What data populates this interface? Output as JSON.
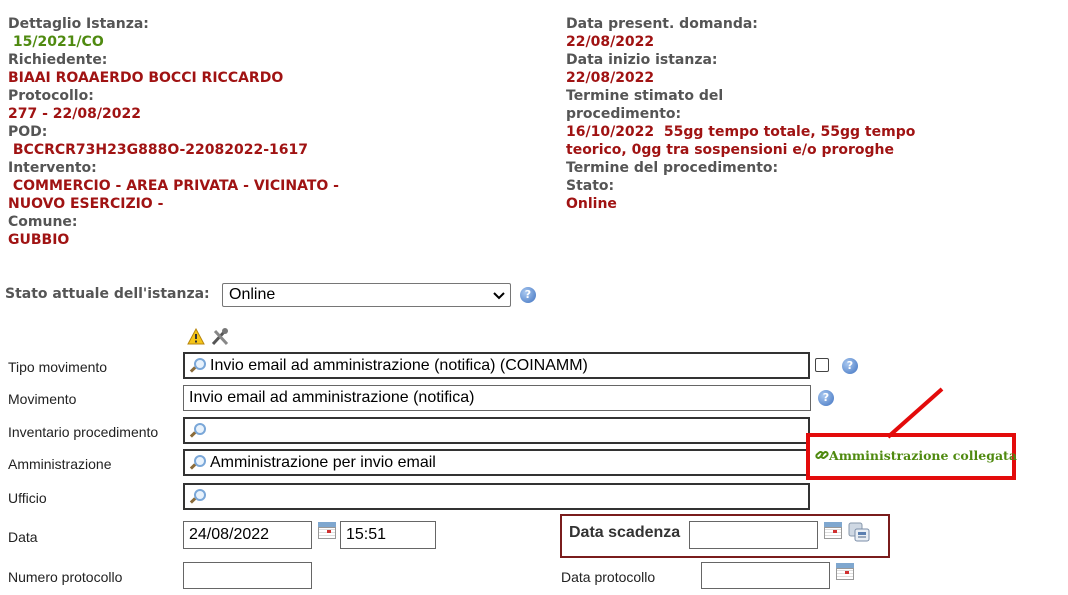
{
  "detail": {
    "left": [
      {
        "label": "Dettaglio Istanza:",
        "value": " 15/2021/CO",
        "value_color": "green"
      },
      {
        "label": "Richiedente:",
        "value": "BIAAI ROAAERDO BOCCI RICCARDO"
      },
      {
        "label": "Protocollo:",
        "value": "277 - 22/08/2022"
      },
      {
        "label": "POD:",
        "value": " BCCRCR73H23G888O-22082022-1617"
      },
      {
        "label": "Intervento:",
        "value_lines": [
          " COMMERCIO - AREA PRIVATA - VICINATO -",
          "NUOVO ESERCIZIO -"
        ]
      },
      {
        "label": "Comune:",
        "value": "GUBBIO"
      }
    ],
    "right": [
      {
        "label": "Data present. domanda:",
        "value": "22/08/2022"
      },
      {
        "label": "Data inizio istanza:",
        "value": "22/08/2022"
      },
      {
        "label_lines": [
          "Termine stimato del",
          "procedimento:"
        ],
        "value_lines": [
          "16/10/2022  55gg tempo totale, 55gg tempo",
          "teorico, 0gg tra sospensioni e/o proroghe"
        ]
      },
      {
        "label": "Termine del procedimento:"
      },
      {
        "label": "Stato:",
        "value": "Online"
      }
    ]
  },
  "stato": {
    "label": "Stato attuale dell'istanza:",
    "selected": "Online",
    "help_icon": "help-icon"
  },
  "toolbar_icons": [
    "warning-icon",
    "tools-icon"
  ],
  "form": {
    "tipo_movimento": {
      "label": "Tipo movimento",
      "value": "Invio email ad amministrazione (notifica) (COINAMM)"
    },
    "movimento": {
      "label": "Movimento",
      "value": "Invio email ad amministrazione (notifica)"
    },
    "inventario": {
      "label": "Inventario procedimento",
      "value": ""
    },
    "amministrazione": {
      "label": "Amministrazione",
      "value": "Amministrazione per invio email"
    },
    "ufficio": {
      "label": "Ufficio",
      "value": ""
    },
    "data": {
      "label": "Data",
      "date": "24/08/2022",
      "time": "15:51"
    },
    "data_scadenza": {
      "label": "Data scadenza",
      "value": ""
    },
    "numero_protocollo": {
      "label": "Numero protocollo",
      "value": ""
    },
    "data_protocollo": {
      "label": "Data protocollo",
      "value": ""
    }
  },
  "link": {
    "text": "Amministrazione collegata",
    "icon": "chain-link-icon"
  },
  "colors": {
    "label": "#555555",
    "value": "#a01313",
    "green": "#4f8a10",
    "highlight": "#e30b0b",
    "scadenza_border": "#7a1c1c"
  }
}
